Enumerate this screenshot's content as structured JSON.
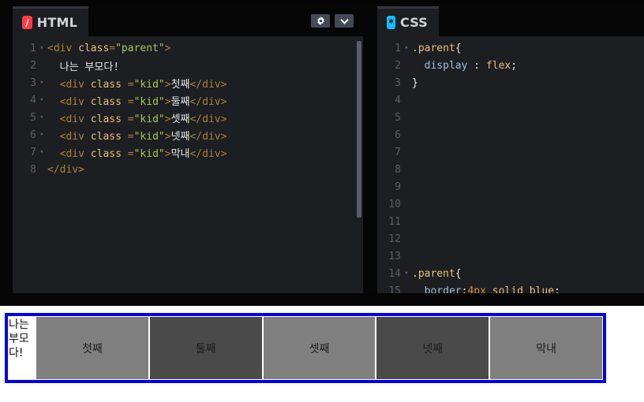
{
  "html_panel": {
    "tab_label": "HTML",
    "icon": "slash-icon",
    "lines": [
      {
        "num": "1",
        "fold": "▾",
        "parts": [
          {
            "c": "t-tag",
            "t": "<div "
          },
          {
            "c": "t-attr",
            "t": "class"
          },
          {
            "c": "t-tag",
            "t": "="
          },
          {
            "c": "t-str",
            "t": "\"parent\""
          },
          {
            "c": "t-tag",
            "t": ">"
          }
        ]
      },
      {
        "num": "2",
        "fold": "",
        "parts": [
          {
            "c": "t-plain",
            "t": "  나는 부모다!"
          }
        ]
      },
      {
        "num": "3",
        "fold": "▾",
        "parts": [
          {
            "c": "t-tag",
            "t": "  <div "
          },
          {
            "c": "t-attr",
            "t": "class "
          },
          {
            "c": "t-tag",
            "t": "="
          },
          {
            "c": "t-str",
            "t": "\"kid\""
          },
          {
            "c": "t-tag",
            "t": ">"
          },
          {
            "c": "t-plain",
            "t": "첫째"
          },
          {
            "c": "t-tag",
            "t": "</div>"
          }
        ]
      },
      {
        "num": "4",
        "fold": "▾",
        "parts": [
          {
            "c": "t-tag",
            "t": "  <div "
          },
          {
            "c": "t-attr",
            "t": "class "
          },
          {
            "c": "t-tag",
            "t": "="
          },
          {
            "c": "t-str",
            "t": "\"kid\""
          },
          {
            "c": "t-tag",
            "t": ">"
          },
          {
            "c": "t-plain",
            "t": "둘째"
          },
          {
            "c": "t-tag",
            "t": "</div>"
          }
        ]
      },
      {
        "num": "5",
        "fold": "▾",
        "parts": [
          {
            "c": "t-tag",
            "t": "  <div "
          },
          {
            "c": "t-attr",
            "t": "class "
          },
          {
            "c": "t-tag",
            "t": "="
          },
          {
            "c": "t-str",
            "t": "\"kid\""
          },
          {
            "c": "t-tag",
            "t": ">"
          },
          {
            "c": "t-plain",
            "t": "셋째"
          },
          {
            "c": "t-tag",
            "t": "</div>"
          }
        ]
      },
      {
        "num": "6",
        "fold": "▾",
        "parts": [
          {
            "c": "t-tag",
            "t": "  <div "
          },
          {
            "c": "t-attr",
            "t": "class "
          },
          {
            "c": "t-tag",
            "t": "="
          },
          {
            "c": "t-str",
            "t": "\"kid\""
          },
          {
            "c": "t-tag",
            "t": ">"
          },
          {
            "c": "t-plain",
            "t": "넷째"
          },
          {
            "c": "t-tag",
            "t": "</div>"
          }
        ]
      },
      {
        "num": "7",
        "fold": "▾",
        "parts": [
          {
            "c": "t-tag",
            "t": "  <div "
          },
          {
            "c": "t-attr",
            "t": "class "
          },
          {
            "c": "t-tag",
            "t": "="
          },
          {
            "c": "t-str",
            "t": "\"kid\""
          },
          {
            "c": "t-tag",
            "t": ">"
          },
          {
            "c": "t-plain",
            "t": "막내"
          },
          {
            "c": "t-tag",
            "t": "</div>"
          }
        ]
      },
      {
        "num": "8",
        "fold": "",
        "parts": [
          {
            "c": "t-tag",
            "t": "</div>"
          }
        ]
      }
    ]
  },
  "css_panel": {
    "tab_label": "CSS",
    "icon": "asterisk-icon",
    "lines": [
      {
        "num": "1",
        "fold": "▾",
        "parts": [
          {
            "c": "t-sel",
            "t": ".parent"
          },
          {
            "c": "t-plain",
            "t": "{"
          }
        ]
      },
      {
        "num": "2",
        "fold": "",
        "parts": [
          {
            "c": "t-prop",
            "t": "  display"
          },
          {
            "c": "t-plain",
            "t": " : "
          },
          {
            "c": "t-val",
            "t": "flex"
          },
          {
            "c": "t-plain",
            "t": ";"
          }
        ]
      },
      {
        "num": "3",
        "fold": "",
        "parts": [
          {
            "c": "t-plain",
            "t": "}"
          }
        ]
      },
      {
        "num": "4",
        "fold": "",
        "parts": []
      },
      {
        "num": "5",
        "fold": "",
        "parts": []
      },
      {
        "num": "6",
        "fold": "",
        "parts": []
      },
      {
        "num": "7",
        "fold": "",
        "parts": []
      },
      {
        "num": "8",
        "fold": "",
        "parts": []
      },
      {
        "num": "9",
        "fold": "",
        "parts": []
      },
      {
        "num": "10",
        "fold": "",
        "parts": []
      },
      {
        "num": "11",
        "fold": "",
        "parts": []
      },
      {
        "num": "12",
        "fold": "",
        "parts": []
      },
      {
        "num": "13",
        "fold": "",
        "parts": []
      },
      {
        "num": "14",
        "fold": "▾",
        "parts": [
          {
            "c": "t-sel",
            "t": ".parent"
          },
          {
            "c": "t-plain",
            "t": "{"
          }
        ]
      },
      {
        "num": "15",
        "fold": "",
        "parts": [
          {
            "c": "t-prop",
            "t": "  border"
          },
          {
            "c": "t-plain",
            "t": ":"
          },
          {
            "c": "t-num",
            "t": "4px"
          },
          {
            "c": "t-val",
            "t": " solid blue"
          },
          {
            "c": "t-plain",
            "t": ";"
          }
        ]
      }
    ]
  },
  "toolbar": {
    "gear_icon": "gear-icon",
    "chevron_icon": "chevron-down-icon"
  },
  "preview": {
    "parent_text": "나는 부모다!",
    "kids": [
      {
        "label": "첫째",
        "shade": "light"
      },
      {
        "label": "둘째",
        "shade": "dark"
      },
      {
        "label": "셋째",
        "shade": "light"
      },
      {
        "label": "넷째",
        "shade": "dark"
      },
      {
        "label": "막내",
        "shade": "light"
      }
    ],
    "border_color": "#0000ee",
    "kid_light_color": "#808080",
    "kid_dark_color": "#4a4a4a"
  },
  "colors": {
    "editor_bg": "#1d1e22",
    "chrome_bg": "#050505",
    "html_icon": "#ff3c41",
    "css_icon": "#0ebeff"
  }
}
